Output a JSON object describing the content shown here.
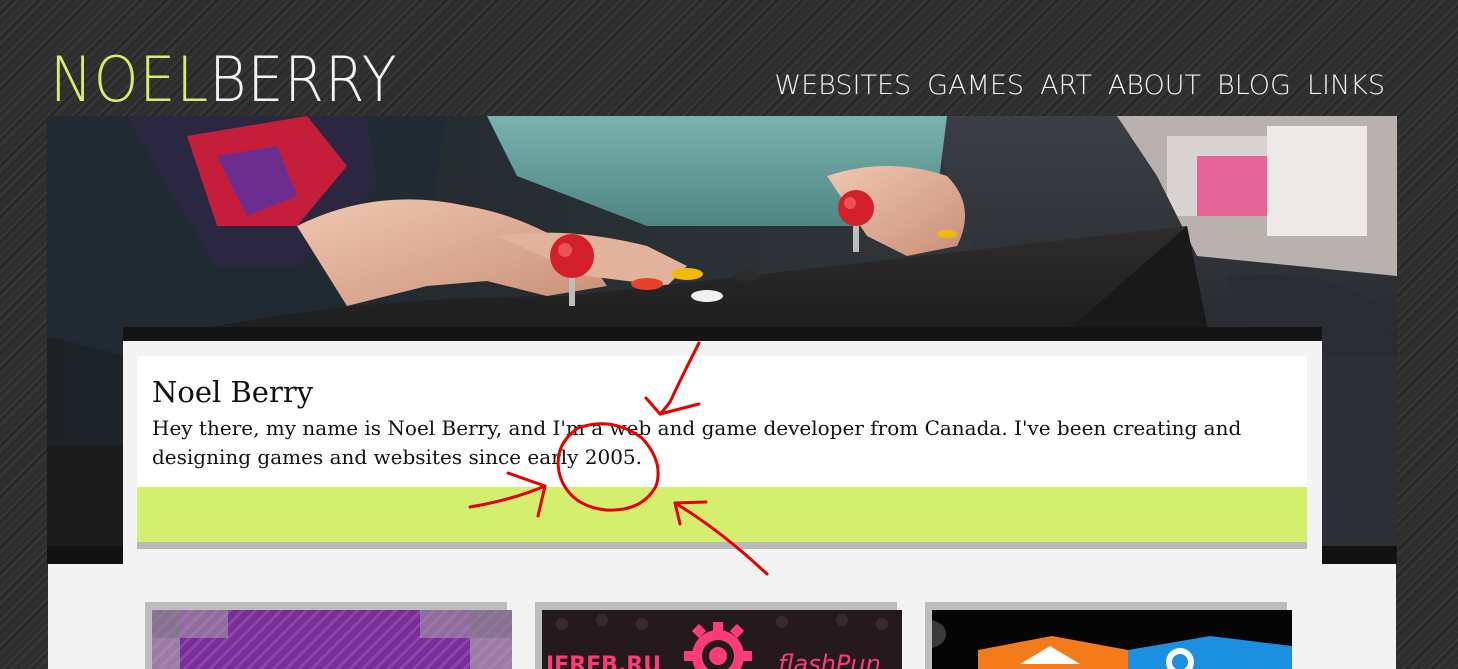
{
  "colors": {
    "accent_green": "#d4ef6e",
    "logo_white": "#f4f4f4",
    "annotation_red": "#e60000"
  },
  "header": {
    "logo": {
      "first": "NOEL",
      "last": "BERRY"
    },
    "nav": [
      {
        "label": "WEBSITES"
      },
      {
        "label": "GAMES"
      },
      {
        "label": "ART"
      },
      {
        "label": "ABOUT"
      },
      {
        "label": "BLOG"
      },
      {
        "label": "LINKS"
      }
    ]
  },
  "intro": {
    "title": "Noel Berry",
    "text": "Hey there, my name is Noel Berry, and I'm a web and game developer from Canada. I've been creating and designing games and websites since early 2005."
  },
  "thumbnails": [
    {
      "icon": "purple-game-thumbnail"
    },
    {
      "icon": "flashpunk-thumbnail",
      "label_left": "JEREB.RU",
      "label_right": "flashPun"
    },
    {
      "icon": "colored-boxes-thumbnail"
    }
  ],
  "annotations": {
    "marks": [
      "arrow-from-top",
      "arrow-from-left",
      "arrow-from-bottom-right",
      "circle-around-2005"
    ]
  }
}
